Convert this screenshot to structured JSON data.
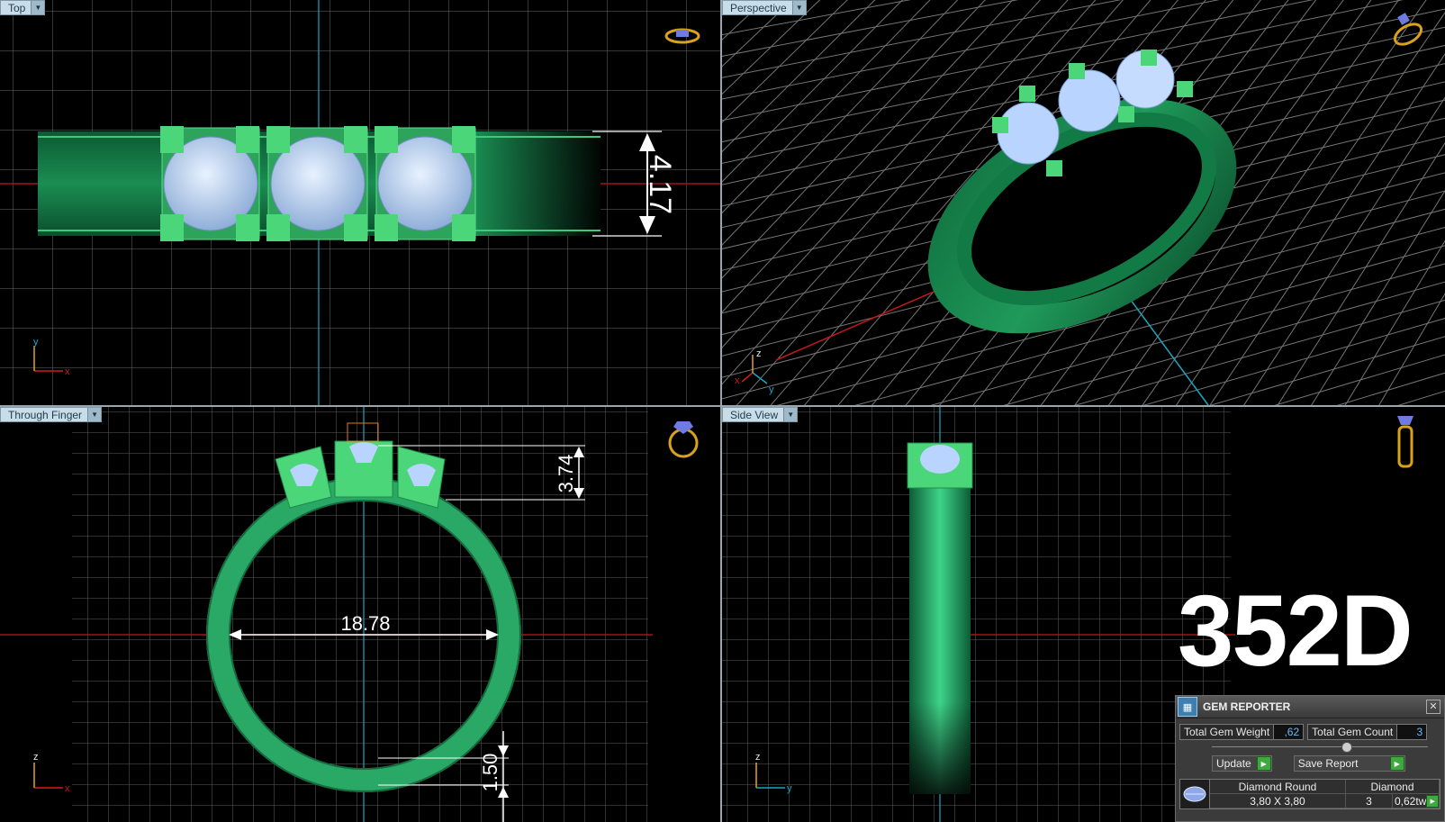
{
  "viewports": {
    "top": {
      "label": "Top",
      "dimension": "4.17"
    },
    "perspective": {
      "label": "Perspective"
    },
    "through_finger": {
      "label": "Through Finger",
      "dim_height": "3.74",
      "dim_diameter": "18.78",
      "dim_thickness": "1.50"
    },
    "side": {
      "label": "Side View"
    }
  },
  "axes": {
    "x": "x",
    "y": "y",
    "z": "z"
  },
  "model_code": "352D",
  "gem_reporter": {
    "title": "GEM REPORTER",
    "total_weight_label": "Total Gem Weight",
    "total_weight_value": ",62",
    "total_count_label": "Total Gem Count",
    "total_count_value": "3",
    "update_label": "Update",
    "save_label": "Save Report",
    "gem_shape": "Diamond Round",
    "gem_size": "3,80 X 3,80",
    "gem_type": "Diamond",
    "gem_count": "3",
    "gem_weight": "0,62tw"
  },
  "colors": {
    "metal": "#1f9a5a",
    "prong": "#4bd67a",
    "stone": "#b8d4ff",
    "grid": "#6f6f6f",
    "axis_x": "#d21a1a",
    "axis_y": "#17a8c4"
  }
}
